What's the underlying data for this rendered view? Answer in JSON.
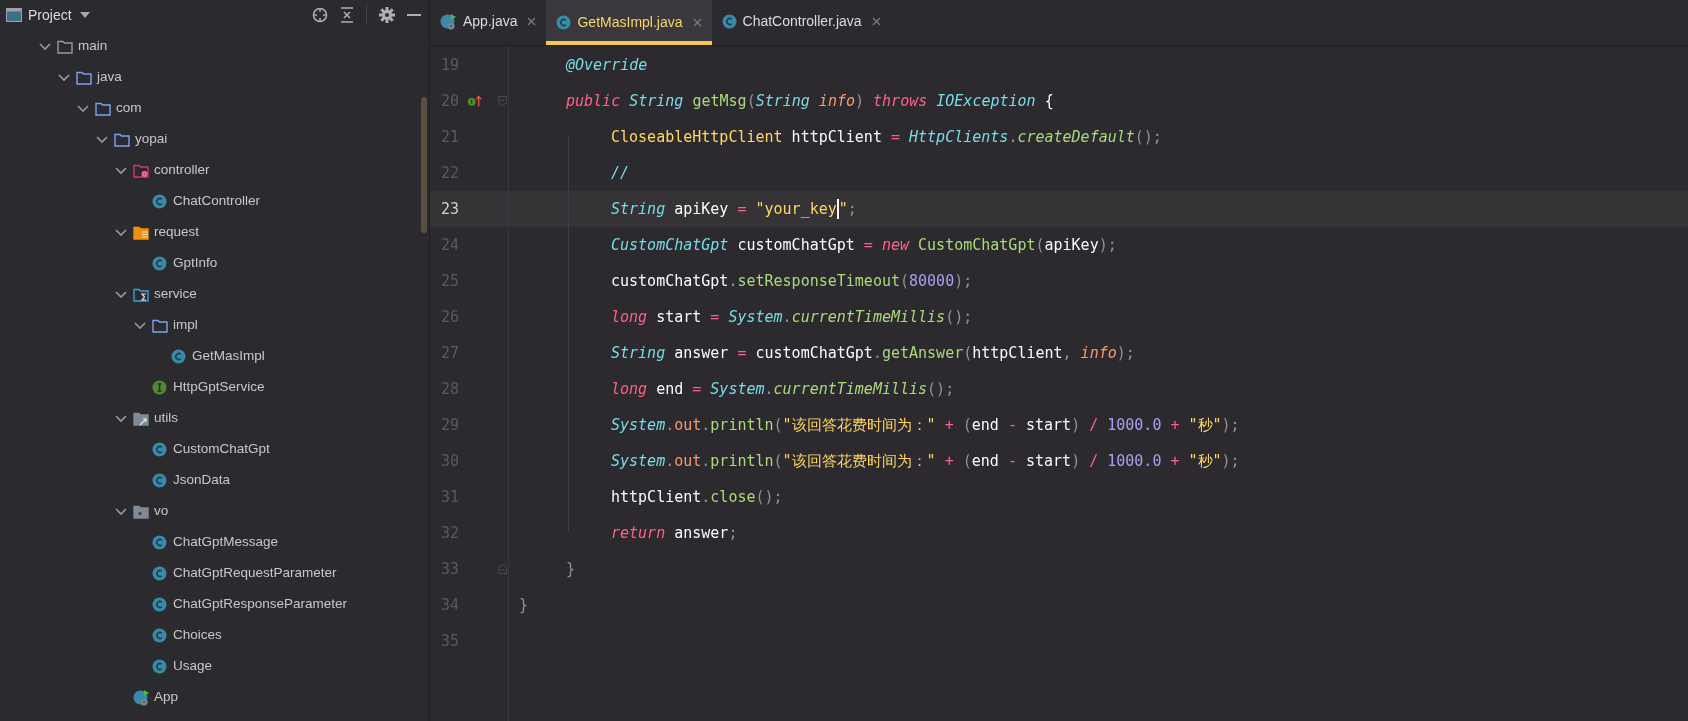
{
  "project_panel": {
    "title": "Project",
    "tree": [
      {
        "label": "main",
        "kind": "folder-grey",
        "expanded": true,
        "children": [
          {
            "label": "java",
            "kind": "folder-blue",
            "expanded": true,
            "children": [
              {
                "label": "com",
                "kind": "folder-blue",
                "expanded": true,
                "children": [
                  {
                    "label": "yopai",
                    "kind": "folder-blue",
                    "expanded": true,
                    "children": [
                      {
                        "label": "controller",
                        "kind": "folder-gear",
                        "expanded": true,
                        "children": [
                          {
                            "label": "ChatController",
                            "kind": "class"
                          }
                        ]
                      },
                      {
                        "label": "request",
                        "kind": "folder-orange",
                        "expanded": true,
                        "children": [
                          {
                            "label": "GptInfo",
                            "kind": "class"
                          }
                        ]
                      },
                      {
                        "label": "service",
                        "kind": "folder-sigma",
                        "expanded": true,
                        "children": [
                          {
                            "label": "impl",
                            "kind": "folder-blue",
                            "expanded": true,
                            "children": [
                              {
                                "label": "GetMasImpl",
                                "kind": "class"
                              }
                            ]
                          },
                          {
                            "label": "HttpGptService",
                            "kind": "interface"
                          }
                        ]
                      },
                      {
                        "label": "utils",
                        "kind": "folder-arrow",
                        "expanded": true,
                        "children": [
                          {
                            "label": "CustomChatGpt",
                            "kind": "class"
                          },
                          {
                            "label": "JsonData",
                            "kind": "class"
                          }
                        ]
                      },
                      {
                        "label": "vo",
                        "kind": "folder-dot",
                        "expanded": true,
                        "children": [
                          {
                            "label": "ChatGptMessage",
                            "kind": "class"
                          },
                          {
                            "label": "ChatGptRequestParameter",
                            "kind": "class"
                          },
                          {
                            "label": "ChatGptResponseParameter",
                            "kind": "class"
                          },
                          {
                            "label": "Choices",
                            "kind": "class"
                          },
                          {
                            "label": "Usage",
                            "kind": "class"
                          }
                        ]
                      },
                      {
                        "label": "App",
                        "kind": "app"
                      }
                    ]
                  }
                ]
              }
            ]
          }
        ]
      }
    ]
  },
  "tabs": [
    {
      "label": "App.java",
      "kind": "app",
      "selected": false
    },
    {
      "label": "GetMasImpl.java",
      "kind": "class",
      "selected": true
    },
    {
      "label": "ChatController.java",
      "kind": "class",
      "selected": false
    }
  ],
  "editor": {
    "lines": [
      {
        "number": "19",
        "current": false,
        "tokens": [
          {
            "kind": "ann",
            "text": "@Override"
          }
        ]
      },
      {
        "number": "20",
        "current": false,
        "marker": {
          "kind": "implements"
        },
        "tokens": [
          {
            "kind": "kw",
            "text": "public"
          },
          {
            "kind": "type",
            "text": " String"
          },
          {
            "kind": "method",
            "text": " getMsg"
          },
          {
            "kind": "punct",
            "text": "("
          },
          {
            "kind": "type",
            "text": "String"
          },
          {
            "kind": "param",
            "text": " info"
          },
          {
            "kind": "punct",
            "text": ")"
          },
          {
            "kind": "kw",
            "text": " throws"
          },
          {
            "kind": "type",
            "text": " IOException"
          },
          {
            "kind": "plain",
            "text": " {"
          }
        ]
      },
      {
        "number": "21",
        "current": false,
        "tokens": [
          {
            "kind": "class",
            "text": "CloseableHttpClient"
          },
          {
            "kind": "plain",
            "text": " httpClient"
          },
          {
            "kind": "op",
            "text": " ="
          },
          {
            "kind": "type",
            "text": " HttpClients"
          },
          {
            "kind": "punct",
            "text": "."
          },
          {
            "kind": "static",
            "text": "createDefault"
          },
          {
            "kind": "punct",
            "text": "();"
          }
        ]
      },
      {
        "number": "22",
        "current": false,
        "tokens": [
          {
            "kind": "comment",
            "text": "//"
          }
        ]
      },
      {
        "number": "23",
        "current": true,
        "tokens": [
          {
            "kind": "type",
            "text": "String"
          },
          {
            "kind": "plain",
            "text": " apiKey"
          },
          {
            "kind": "op",
            "text": " ="
          },
          {
            "kind": "string",
            "text": " \"your_key",
            "caret": true
          },
          {
            "kind": "string",
            "text": "\""
          },
          {
            "kind": "punct",
            "text": ";"
          }
        ]
      },
      {
        "number": "24",
        "current": false,
        "tokens": [
          {
            "kind": "type",
            "text": "CustomChatGpt"
          },
          {
            "kind": "plain",
            "text": " customChatGpt"
          },
          {
            "kind": "op",
            "text": " ="
          },
          {
            "kind": "kw",
            "text": " new"
          },
          {
            "kind": "ctor",
            "text": " CustomChatGpt"
          },
          {
            "kind": "punct",
            "text": "("
          },
          {
            "kind": "plain",
            "text": "apiKey"
          },
          {
            "kind": "punct",
            "text": ");"
          }
        ]
      },
      {
        "number": "25",
        "current": false,
        "tokens": [
          {
            "kind": "plain",
            "text": "customChatGpt"
          },
          {
            "kind": "punct",
            "text": "."
          },
          {
            "kind": "method",
            "text": "setResponseTimeout"
          },
          {
            "kind": "punct",
            "text": "("
          },
          {
            "kind": "num",
            "text": "80000"
          },
          {
            "kind": "punct",
            "text": ");"
          }
        ]
      },
      {
        "number": "26",
        "current": false,
        "tokens": [
          {
            "kind": "kw",
            "text": "long"
          },
          {
            "kind": "plain",
            "text": " start"
          },
          {
            "kind": "op",
            "text": " ="
          },
          {
            "kind": "type",
            "text": " System"
          },
          {
            "kind": "punct",
            "text": "."
          },
          {
            "kind": "static",
            "text": "currentTimeMillis"
          },
          {
            "kind": "punct",
            "text": "();"
          }
        ]
      },
      {
        "number": "27",
        "current": false,
        "tokens": [
          {
            "kind": "type",
            "text": "String"
          },
          {
            "kind": "plain",
            "text": " answer"
          },
          {
            "kind": "op",
            "text": " ="
          },
          {
            "kind": "plain",
            "text": " customChatGpt"
          },
          {
            "kind": "punct",
            "text": "."
          },
          {
            "kind": "method",
            "text": "getAnswer"
          },
          {
            "kind": "punct",
            "text": "("
          },
          {
            "kind": "plain",
            "text": "httpClient"
          },
          {
            "kind": "punct",
            "text": ","
          },
          {
            "kind": "param",
            "text": " info"
          },
          {
            "kind": "punct",
            "text": ");"
          }
        ]
      },
      {
        "number": "28",
        "current": false,
        "tokens": [
          {
            "kind": "kw",
            "text": "long"
          },
          {
            "kind": "plain",
            "text": " end"
          },
          {
            "kind": "op",
            "text": " ="
          },
          {
            "kind": "type",
            "text": " System"
          },
          {
            "kind": "punct",
            "text": "."
          },
          {
            "kind": "static",
            "text": "currentTimeMillis"
          },
          {
            "kind": "punct",
            "text": "();"
          }
        ]
      },
      {
        "number": "29",
        "current": false,
        "tokens": [
          {
            "kind": "type",
            "text": "System"
          },
          {
            "kind": "punct",
            "text": "."
          },
          {
            "kind": "field",
            "text": "out"
          },
          {
            "kind": "punct",
            "text": "."
          },
          {
            "kind": "method",
            "text": "println"
          },
          {
            "kind": "punct",
            "text": "("
          },
          {
            "kind": "string",
            "text": "\"该回答花费时间为：\""
          },
          {
            "kind": "op",
            "text": " +"
          },
          {
            "kind": "punct",
            "text": " ("
          },
          {
            "kind": "plain",
            "text": "end"
          },
          {
            "kind": "op",
            "text": " -"
          },
          {
            "kind": "plain",
            "text": " start"
          },
          {
            "kind": "punct",
            "text": ")"
          },
          {
            "kind": "op",
            "text": " /"
          },
          {
            "kind": "num",
            "text": " 1000.0"
          },
          {
            "kind": "op",
            "text": " +"
          },
          {
            "kind": "string",
            "text": " \"秒\""
          },
          {
            "kind": "punct",
            "text": ");"
          }
        ]
      },
      {
        "number": "30",
        "current": false,
        "tokens": [
          {
            "kind": "type",
            "text": "System"
          },
          {
            "kind": "punct",
            "text": "."
          },
          {
            "kind": "field",
            "text": "out"
          },
          {
            "kind": "punct",
            "text": "."
          },
          {
            "kind": "method",
            "text": "println"
          },
          {
            "kind": "punct",
            "text": "("
          },
          {
            "kind": "string",
            "text": "\"该回答花费时间为：\""
          },
          {
            "kind": "op",
            "text": " +"
          },
          {
            "kind": "punct",
            "text": " ("
          },
          {
            "kind": "plain",
            "text": "end"
          },
          {
            "kind": "op",
            "text": " -"
          },
          {
            "kind": "plain",
            "text": " start"
          },
          {
            "kind": "punct",
            "text": ")"
          },
          {
            "kind": "op",
            "text": " /"
          },
          {
            "kind": "num",
            "text": " 1000.0"
          },
          {
            "kind": "op",
            "text": " +"
          },
          {
            "kind": "string",
            "text": " \"秒\""
          },
          {
            "kind": "punct",
            "text": ");"
          }
        ]
      },
      {
        "number": "31",
        "current": false,
        "tokens": [
          {
            "kind": "plain",
            "text": "httpClient"
          },
          {
            "kind": "punct",
            "text": "."
          },
          {
            "kind": "method",
            "text": "close"
          },
          {
            "kind": "punct",
            "text": "();"
          }
        ]
      },
      {
        "number": "32",
        "current": false,
        "tokens": [
          {
            "kind": "kw",
            "text": "return"
          },
          {
            "kind": "plain",
            "text": " answer"
          },
          {
            "kind": "punct",
            "text": ";"
          }
        ]
      },
      {
        "number": "33",
        "current": false,
        "marker": {
          "kind": "fold-end"
        },
        "tokens": [
          {
            "kind": "punct",
            "text": "}"
          }
        ]
      },
      {
        "number": "34",
        "current": false,
        "tokens": [
          {
            "kind": "punct",
            "text": "}"
          }
        ]
      },
      {
        "number": "35",
        "current": false
      }
    ]
  }
}
